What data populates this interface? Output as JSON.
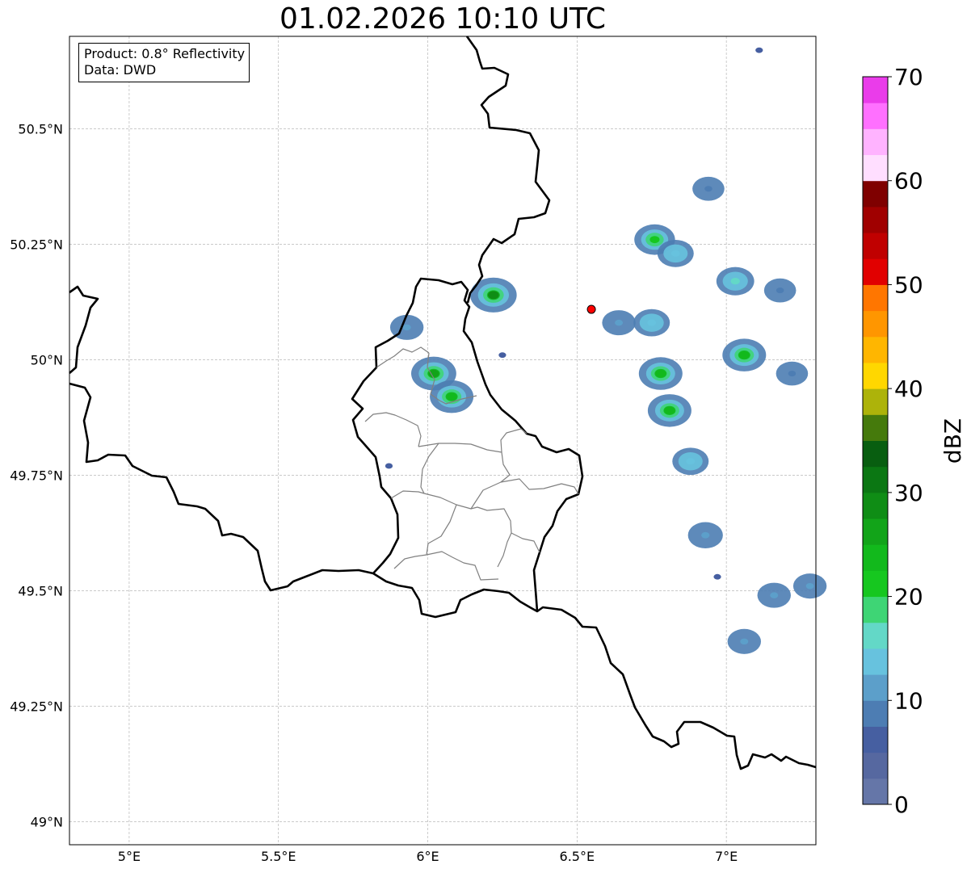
{
  "title": "01.02.2026 10:10 UTC",
  "info": {
    "product": "Product: 0.8° Reflectivity",
    "data": "Data: DWD"
  },
  "map": {
    "lon_range": [
      4.8,
      7.3
    ],
    "lat_range": [
      48.95,
      50.7
    ],
    "lon_ticks": [
      {
        "value": 5.0,
        "label": "5°E"
      },
      {
        "value": 5.5,
        "label": "5.5°E"
      },
      {
        "value": 6.0,
        "label": "6°E"
      },
      {
        "value": 6.5,
        "label": "6.5°E"
      },
      {
        "value": 7.0,
        "label": "7°E"
      }
    ],
    "lat_ticks": [
      {
        "value": 49.0,
        "label": "49°N"
      },
      {
        "value": 49.25,
        "label": "49.25°N"
      },
      {
        "value": 49.5,
        "label": "49.5°N"
      },
      {
        "value": 49.75,
        "label": "49.75°N"
      },
      {
        "value": 50.0,
        "label": "50°N"
      },
      {
        "value": 50.25,
        "label": "50.25°N"
      },
      {
        "value": 50.5,
        "label": "50.5°N"
      }
    ],
    "grid": true,
    "radar_site": {
      "lon": 6.548,
      "lat": 50.109,
      "color": "#ff0000"
    }
  },
  "colorbar": {
    "label": "dBZ",
    "min": 0,
    "max": 70,
    "step": 2.5,
    "tick_values": [
      0,
      10,
      20,
      30,
      40,
      50,
      60,
      70
    ],
    "tick_labels": [
      "0",
      "10",
      "20",
      "30",
      "40",
      "50",
      "60",
      "70"
    ],
    "colors": [
      "#6576a8",
      "#5668a0",
      "#465fa1",
      "#4d7db3",
      "#5c9fca",
      "#67c2de",
      "#63d8c7",
      "#3ed575",
      "#16c71f",
      "#12b91c",
      "#12a419",
      "#0f8d15",
      "#0b7713",
      "#085e10",
      "#457a0c",
      "#adb30a",
      "#ffd700",
      "#ffb600",
      "#ff9600",
      "#ff7600",
      "#e10000",
      "#c00000",
      "#a00000",
      "#7f0000",
      "#ffdeff",
      "#ffb3ff",
      "#ff70ff",
      "#ea3cea"
    ]
  },
  "echoes": [
    {
      "lon": 6.22,
      "lat": 50.14,
      "dbz": 28
    },
    {
      "lon": 6.02,
      "lat": 49.97,
      "dbz": 26
    },
    {
      "lon": 6.08,
      "lat": 49.92,
      "dbz": 24
    },
    {
      "lon": 5.93,
      "lat": 50.07,
      "dbz": 10
    },
    {
      "lon": 6.75,
      "lat": 50.08,
      "dbz": 14
    },
    {
      "lon": 6.78,
      "lat": 49.97,
      "dbz": 24
    },
    {
      "lon": 6.81,
      "lat": 49.89,
      "dbz": 24
    },
    {
      "lon": 6.76,
      "lat": 50.26,
      "dbz": 20
    },
    {
      "lon": 6.83,
      "lat": 50.23,
      "dbz": 14
    },
    {
      "lon": 7.06,
      "lat": 50.01,
      "dbz": 24
    },
    {
      "lon": 7.03,
      "lat": 50.17,
      "dbz": 16
    },
    {
      "lon": 6.64,
      "lat": 50.08,
      "dbz": 10
    },
    {
      "lon": 6.88,
      "lat": 49.78,
      "dbz": 14
    },
    {
      "lon": 6.93,
      "lat": 49.62,
      "dbz": 12
    },
    {
      "lon": 7.28,
      "lat": 49.51,
      "dbz": 10
    },
    {
      "lon": 7.16,
      "lat": 49.49,
      "dbz": 10
    },
    {
      "lon": 7.06,
      "lat": 49.39,
      "dbz": 10
    },
    {
      "lon": 7.18,
      "lat": 50.15,
      "dbz": 8
    },
    {
      "lon": 7.22,
      "lat": 49.97,
      "dbz": 8
    },
    {
      "lon": 6.94,
      "lat": 50.37,
      "dbz": 8
    },
    {
      "lon": 7.11,
      "lat": 50.67,
      "dbz": 6
    },
    {
      "lon": 5.87,
      "lat": 49.77,
      "dbz": 6
    },
    {
      "lon": 6.25,
      "lat": 50.01,
      "dbz": 6
    },
    {
      "lon": 6.97,
      "lat": 49.53,
      "dbz": 6
    }
  ]
}
